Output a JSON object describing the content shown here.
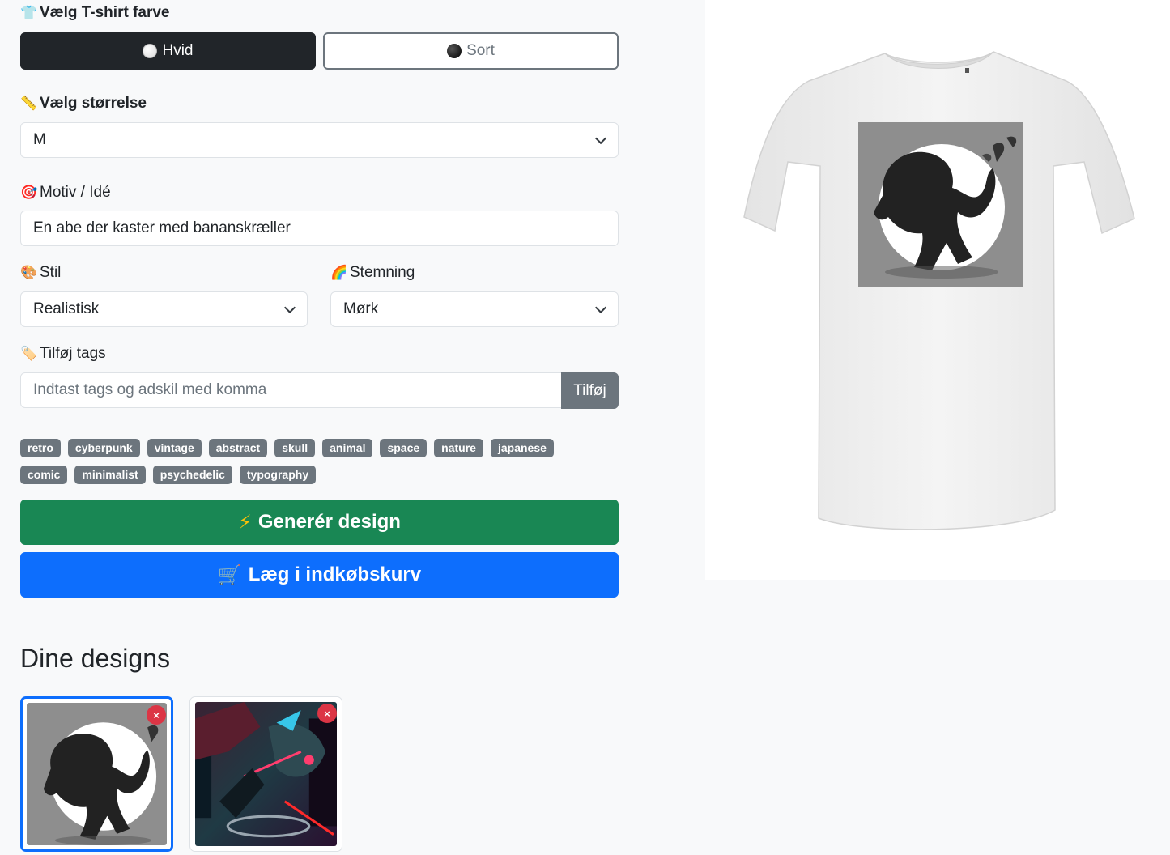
{
  "color_section": {
    "label": "Vælg T-shirt farve",
    "icon": "tshirt-icon",
    "options": [
      {
        "label": "Hvid",
        "icon": "white-circle-icon",
        "active": true
      },
      {
        "label": "Sort",
        "icon": "black-circle-icon",
        "active": false
      }
    ]
  },
  "size_section": {
    "label": "Vælg størrelse",
    "icon": "ruler-icon",
    "selected": "M"
  },
  "motif_section": {
    "label": "Motiv / Idé",
    "icon": "target-icon",
    "value": "En abe der kaster med bananskræller"
  },
  "style_section": {
    "label": "Stil",
    "icon": "palette-icon",
    "selected": "Realistisk"
  },
  "mood_section": {
    "label": "Stemning",
    "icon": "rainbow-icon",
    "selected": "Mørk"
  },
  "tags_section": {
    "label": "Tilføj tags",
    "icon": "label-icon",
    "placeholder": "Indtast tags og adskil med komma",
    "add_label": "Tilføj",
    "tags_row1": [
      "retro",
      "cyberpunk",
      "vintage",
      "abstract",
      "skull",
      "animal",
      "space",
      "nature",
      "japanese"
    ],
    "tags_row2": [
      "comic",
      "minimalist",
      "psychedelic",
      "typography"
    ]
  },
  "actions": {
    "generate_label": "Generér design",
    "generate_icon": "lightning-icon",
    "cart_label": "Læg i indkøbskurv",
    "cart_icon": "shopping-cart-icon"
  },
  "designs": {
    "title": "Dine designs",
    "items": [
      {
        "name": "monkey-design",
        "selected": true,
        "delete_label": "×"
      },
      {
        "name": "cyberpunk-dragon-design",
        "selected": false,
        "delete_label": "×"
      }
    ]
  },
  "colors": {
    "dark": "#212529",
    "secondary": "#6c757d",
    "success": "#198754",
    "primary": "#0d6efd",
    "danger": "#dc3545"
  }
}
